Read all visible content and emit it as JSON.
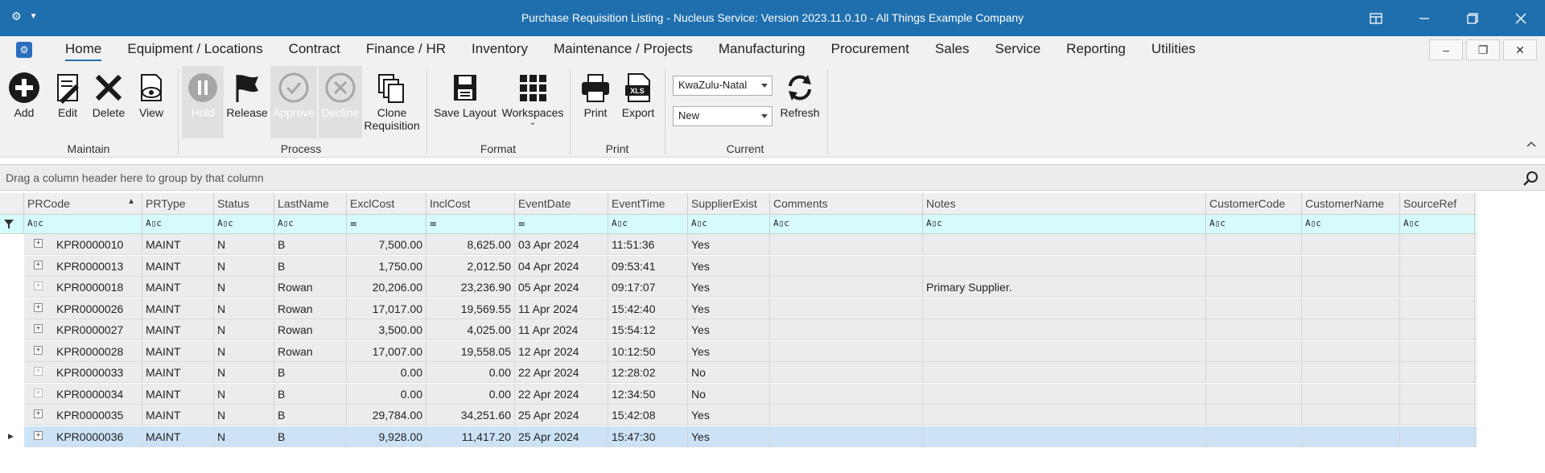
{
  "window": {
    "title": "Purchase Requisition Listing - Nucleus Service: Version 2023.11.0.10 - All Things Example Company"
  },
  "menu": {
    "items": [
      "Home",
      "Equipment / Locations",
      "Contract",
      "Finance / HR",
      "Inventory",
      "Maintenance / Projects",
      "Manufacturing",
      "Procurement",
      "Sales",
      "Service",
      "Reporting",
      "Utilities"
    ],
    "active": "Home"
  },
  "ribbon": {
    "maintain": {
      "group": "Maintain",
      "add": "Add",
      "edit": "Edit",
      "delete": "Delete",
      "view": "View"
    },
    "process": {
      "group": "Process",
      "hold": "Hold",
      "release": "Release",
      "approve": "Approve",
      "decline": "Decline",
      "clone_line1": "Clone",
      "clone_line2": "Requisition"
    },
    "format": {
      "group": "Format",
      "save_layout": "Save Layout",
      "workspaces": "Workspaces"
    },
    "print": {
      "group": "Print",
      "print": "Print",
      "export": "Export"
    },
    "current": {
      "group": "Current",
      "region": "KwaZulu-Natal",
      "status": "New",
      "refresh": "Refresh"
    }
  },
  "grid": {
    "group_panel_text": "Drag a column header here to group by that column",
    "columns": [
      "PRCode",
      "PRType",
      "Status",
      "LastName",
      "ExclCost",
      "InclCost",
      "EventDate",
      "EventTime",
      "SupplierExist",
      "Comments",
      "Notes",
      "CustomerCode",
      "CustomerName",
      "SourceRef"
    ],
    "sorted_column": "PRCode",
    "filter_text_icon": "A▯c",
    "filter_eq_icon": "=",
    "rows": [
      {
        "prcode": "KPR0000010",
        "prtype": "MAINT",
        "status": "N",
        "lastname": "B",
        "excl": "7,500.00",
        "incl": "8,625.00",
        "date": "03 Apr 2024",
        "time": "11:51:36",
        "supplier": "Yes",
        "comments": "",
        "notes": ""
      },
      {
        "prcode": "KPR0000013",
        "prtype": "MAINT",
        "status": "N",
        "lastname": "B",
        "excl": "1,750.00",
        "incl": "2,012.50",
        "date": "04 Apr 2024",
        "time": "09:53:41",
        "supplier": "Yes",
        "comments": "",
        "notes": ""
      },
      {
        "prcode": "KPR0000018",
        "prtype": "MAINT",
        "status": "N",
        "lastname": "Rowan",
        "excl": "20,206.00",
        "incl": "23,236.90",
        "date": "05 Apr 2024",
        "time": "09:17:07",
        "supplier": "Yes",
        "comments": "",
        "notes": "Primary Supplier."
      },
      {
        "prcode": "KPR0000026",
        "prtype": "MAINT",
        "status": "N",
        "lastname": "Rowan",
        "excl": "17,017.00",
        "incl": "19,569.55",
        "date": "11 Apr 2024",
        "time": "15:42:40",
        "supplier": "Yes",
        "comments": "",
        "notes": ""
      },
      {
        "prcode": "KPR0000027",
        "prtype": "MAINT",
        "status": "N",
        "lastname": "Rowan",
        "excl": "3,500.00",
        "incl": "4,025.00",
        "date": "11 Apr 2024",
        "time": "15:54:12",
        "supplier": "Yes",
        "comments": "",
        "notes": ""
      },
      {
        "prcode": "KPR0000028",
        "prtype": "MAINT",
        "status": "N",
        "lastname": "Rowan",
        "excl": "17,007.00",
        "incl": "19,558.05",
        "date": "12 Apr 2024",
        "time": "10:12:50",
        "supplier": "Yes",
        "comments": "",
        "notes": ""
      },
      {
        "prcode": "KPR0000033",
        "prtype": "MAINT",
        "status": "N",
        "lastname": "B",
        "excl": "0.00",
        "incl": "0.00",
        "date": "22 Apr 2024",
        "time": "12:28:02",
        "supplier": "No",
        "comments": "",
        "notes": ""
      },
      {
        "prcode": "KPR0000034",
        "prtype": "MAINT",
        "status": "N",
        "lastname": "B",
        "excl": "0.00",
        "incl": "0.00",
        "date": "22 Apr 2024",
        "time": "12:34:50",
        "supplier": "No",
        "comments": "",
        "notes": ""
      },
      {
        "prcode": "KPR0000035",
        "prtype": "MAINT",
        "status": "N",
        "lastname": "B",
        "excl": "29,784.00",
        "incl": "34,251.60",
        "date": "25 Apr 2024",
        "time": "15:42:08",
        "supplier": "Yes",
        "comments": "",
        "notes": ""
      },
      {
        "prcode": "KPR0000036",
        "prtype": "MAINT",
        "status": "N",
        "lastname": "B",
        "excl": "9,928.00",
        "incl": "11,417.20",
        "date": "25 Apr 2024",
        "time": "15:47:30",
        "supplier": "Yes",
        "comments": "",
        "notes": ""
      }
    ],
    "selected_row": 9
  },
  "colors": {
    "titlebar": "#1f6fae",
    "filter_row": "#d6fbfb",
    "selected_row": "#cce3f7",
    "active_tab_underline": "#1f6fae"
  }
}
